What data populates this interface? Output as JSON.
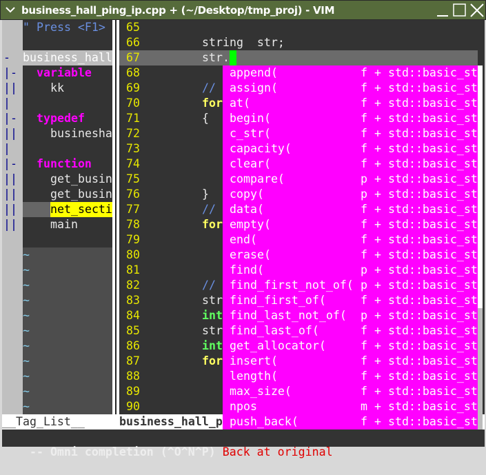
{
  "window": {
    "title": "business_hall_ping_ip.cpp + (~/Desktop/tmp_proj) - VIM",
    "menu_icon": "chevron-down-icon",
    "buttons": [
      "minimize",
      "maximize",
      "close"
    ]
  },
  "taglist": {
    "hint": "\" Press <F1>",
    "root": "business_hall",
    "groups": [
      {
        "label": "variable",
        "items": [
          "kk"
        ]
      },
      {
        "label": "typedef",
        "items": [
          "businesha"
        ]
      },
      {
        "label": "function",
        "items": [
          "get_busin",
          "get_busin",
          "net_secti",
          "main"
        ]
      }
    ],
    "status": "__Tag_List__"
  },
  "editor": {
    "lines": [
      65,
      66,
      67,
      68,
      69,
      70,
      71,
      72,
      73,
      74,
      75,
      76,
      77,
      78,
      79,
      80,
      81,
      82,
      83,
      84,
      85,
      86,
      87,
      88,
      89,
      90
    ],
    "code": {
      "66": "string  str;",
      "67": "str.",
      "69": "//",
      "70": "for",
      "71": "{",
      "76": "}",
      "77": "//",
      "78": "for",
      "82": "//",
      "83": "str",
      "84": "int",
      "85": "str",
      "86": "int",
      "87": "for"
    },
    "status": "business_hall_p"
  },
  "completion": {
    "items": [
      {
        "word": "append(",
        "kind": "f",
        "info": "+ std::basic_st"
      },
      {
        "word": "assign(",
        "kind": "f",
        "info": "+ std::basic_st"
      },
      {
        "word": "at(",
        "kind": "f",
        "info": "+ std::basic_st"
      },
      {
        "word": "begin(",
        "kind": "f",
        "info": "+ std::basic_st"
      },
      {
        "word": "c_str(",
        "kind": "f",
        "info": "+ std::basic_st"
      },
      {
        "word": "capacity(",
        "kind": "f",
        "info": "+ std::basic_st"
      },
      {
        "word": "clear(",
        "kind": "f",
        "info": "+ std::basic_st"
      },
      {
        "word": "compare(",
        "kind": "p",
        "info": "+ std::basic_st"
      },
      {
        "word": "copy(",
        "kind": "p",
        "info": "+ std::basic_st"
      },
      {
        "word": "data(",
        "kind": "f",
        "info": "+ std::basic_st"
      },
      {
        "word": "empty(",
        "kind": "f",
        "info": "+ std::basic_st"
      },
      {
        "word": "end(",
        "kind": "f",
        "info": "+ std::basic_st"
      },
      {
        "word": "erase(",
        "kind": "f",
        "info": "+ std::basic_st"
      },
      {
        "word": "find(",
        "kind": "p",
        "info": "+ std::basic_st"
      },
      {
        "word": "find_first_not_of(",
        "kind": "p",
        "info": "+ std::basic_st"
      },
      {
        "word": "find_first_of(",
        "kind": "f",
        "info": "+ std::basic_st"
      },
      {
        "word": "find_last_not_of(",
        "kind": "p",
        "info": "+ std::basic_st"
      },
      {
        "word": "find_last_of(",
        "kind": "f",
        "info": "+ std::basic_st"
      },
      {
        "word": "get_allocator(",
        "kind": "f",
        "info": "+ std::basic_st"
      },
      {
        "word": "insert(",
        "kind": "f",
        "info": "+ std::basic_st"
      },
      {
        "word": "length(",
        "kind": "f",
        "info": "+ std::basic_st"
      },
      {
        "word": "max_size(",
        "kind": "f",
        "info": "+ std::basic_st"
      },
      {
        "word": "npos",
        "kind": "m",
        "info": "+ std::basic_st"
      },
      {
        "word": "push_back(",
        "kind": "f",
        "info": "+ std::basic_st"
      }
    ],
    "scroll_fraction_visible": 0.67
  },
  "cmdline": {
    "mode": "-- Omni completion (^O^N^P)",
    "message": "Back at original"
  },
  "colors": {
    "popup": "#ff00ff",
    "cursor": "#00ff00",
    "title_bar": "#566b3b",
    "line_number": "#e6e600",
    "taglist_kind": "#ff00ff",
    "message": "#e00000"
  }
}
